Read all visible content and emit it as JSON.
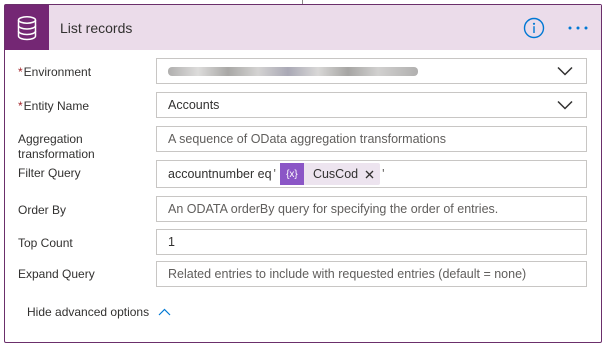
{
  "card": {
    "title": "List records",
    "icon": "database-icon",
    "accent": "#742774",
    "header_bg": "#ebdcea"
  },
  "fields": {
    "environment": {
      "label": "Environment",
      "required": "*",
      "value": ""
    },
    "entity": {
      "label": "Entity Name",
      "required": "*",
      "value": "Accounts"
    },
    "aggregation": {
      "label": "Aggregation transformation",
      "placeholder": "A sequence of OData aggregation transformations"
    },
    "filter": {
      "label": "Filter Query",
      "prefix": "accountnumber eq",
      "open_quote": "'",
      "token_icon": "{x}",
      "token_label": "CusCod",
      "close_quote": "'"
    },
    "order": {
      "label": "Order By",
      "placeholder": "An ODATA orderBy query for specifying the order of entries."
    },
    "top": {
      "label": "Top Count",
      "value": "1"
    },
    "expand": {
      "label": "Expand Query",
      "placeholder": "Related entries to include with requested entries (default = none)"
    }
  },
  "footer": {
    "hide_advanced_label": "Hide advanced options"
  },
  "colors": {
    "info_blue": "#0078d4",
    "token_purple": "#8b56c6",
    "required_red": "#a4262c"
  }
}
